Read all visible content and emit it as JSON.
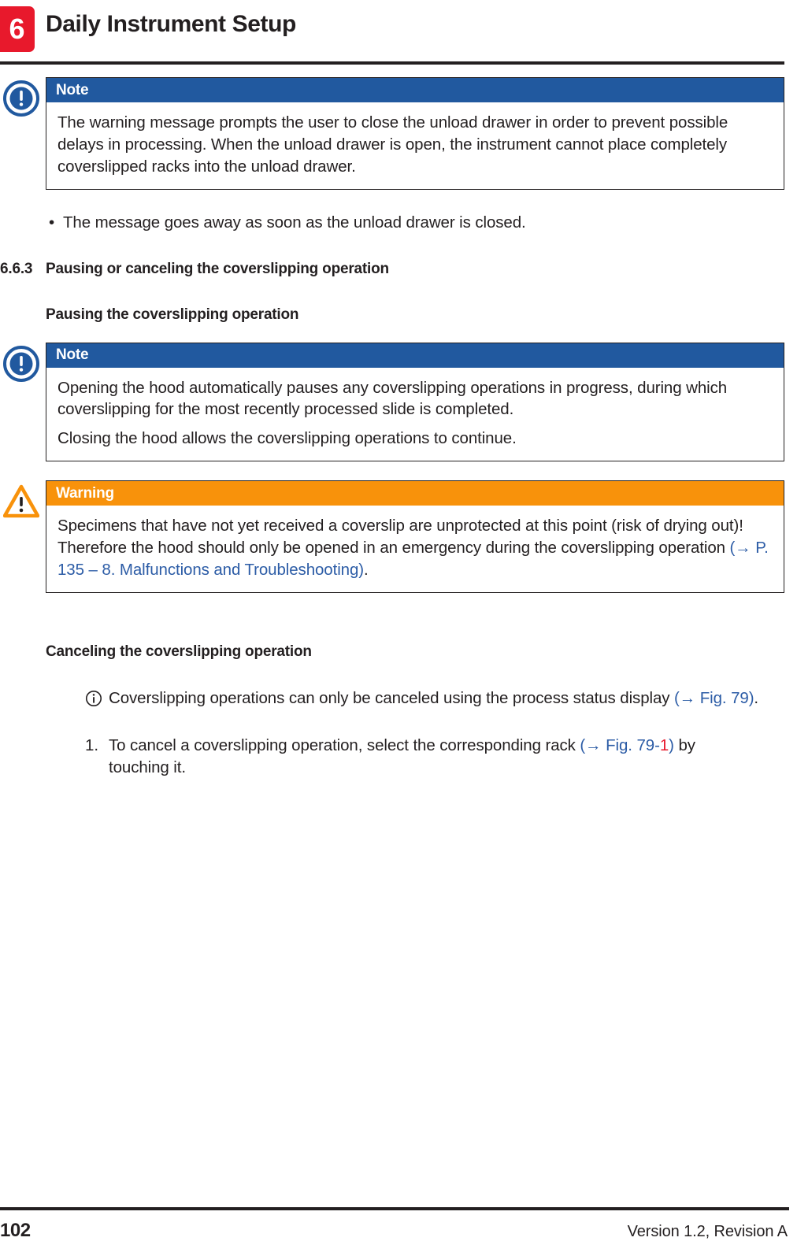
{
  "header": {
    "chapter_number": "6",
    "chapter_title": "Daily Instrument Setup"
  },
  "note_box_1": {
    "icon": "note-circle-exclamation-icon",
    "label": "Note",
    "paragraphs": [
      "The warning message prompts the user to close the unload drawer in order to prevent possible delays in processing. When the unload drawer is open, the instrument cannot place completely coverslipped racks into the unload drawer."
    ]
  },
  "bullet_1": {
    "marker": "•",
    "text": "The message goes away as soon as the unload drawer is closed."
  },
  "section": {
    "number": "6.6.3",
    "title": "Pausing or canceling the coverslipping operation"
  },
  "sub_heading_1": "Pausing the coverslipping operation",
  "note_box_2": {
    "icon": "note-circle-exclamation-icon",
    "label": "Note",
    "paragraphs": [
      "Opening the hood automatically pauses any coverslipping operations in progress, during which coverslipping for the most recently processed slide is completed.",
      "Closing the hood allows the coverslipping operations to continue."
    ]
  },
  "warning_box": {
    "icon": "warning-triangle-icon",
    "label": "Warning",
    "text_before": "Specimens that have not yet received a coverslip are unprotected at this point (risk of drying out)! Therefore the hood should only be opened in an emergency during the coverslipping operation ",
    "xref": "(→ P. 135 – 8. Malfunctions and Troubleshooting)",
    "text_after": "."
  },
  "sub_heading_2": "Canceling the coverslipping operation",
  "info_note": {
    "icon": "info-circle-icon",
    "text_before": "Coverslipping operations can only be canceled using the process status display ",
    "xref": "(→ Fig.  79)",
    "text_after": "."
  },
  "numbered_step_1": {
    "marker": "1.",
    "text_before": "To cancel a coverslipping operation, select the corresponding rack ",
    "xref_blue_open": "(→ Fig.  79-",
    "xref_red": "1",
    "xref_blue_close": ")",
    "text_after": " by touching it."
  },
  "footer": {
    "page_number": "102",
    "version": "Version 1.2, Revision A"
  },
  "colors": {
    "note_blue": "#21599f",
    "warning_orange": "#f8920b",
    "chapter_red": "#e8192c",
    "link_blue": "#2c5ca6",
    "text_black": "#231f20"
  }
}
